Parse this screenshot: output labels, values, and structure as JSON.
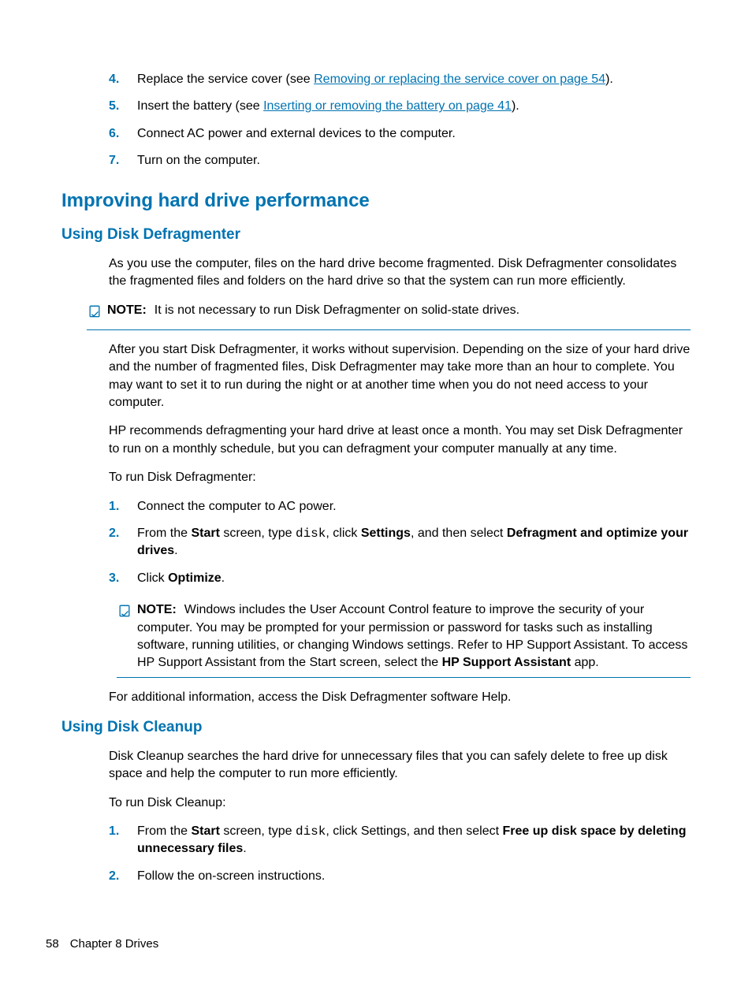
{
  "topList": {
    "items": [
      {
        "num": "4.",
        "pre": "Replace the service cover (see ",
        "link": "Removing or replacing the service cover on page 54",
        "post": ")."
      },
      {
        "num": "5.",
        "pre": "Insert the battery (see ",
        "link": "Inserting or removing the battery on page 41",
        "post": ")."
      },
      {
        "num": "6.",
        "text": "Connect AC power and external devices to the computer."
      },
      {
        "num": "7.",
        "text": "Turn on the computer."
      }
    ]
  },
  "section1": {
    "title": "Improving hard drive performance",
    "sub1": {
      "title": "Using Disk Defragmenter",
      "p1": "As you use the computer, files on the hard drive become fragmented. Disk Defragmenter consolidates the fragmented files and folders on the hard drive so that the system can run more efficiently.",
      "note1": {
        "label": "NOTE:",
        "text": "It is not necessary to run Disk Defragmenter on solid-state drives."
      },
      "p2": "After you start Disk Defragmenter, it works without supervision. Depending on the size of your hard drive and the number of fragmented files, Disk Defragmenter may take more than an hour to complete. You may want to set it to run during the night or at another time when you do not need access to your computer.",
      "p3": "HP recommends defragmenting your hard drive at least once a month. You may set Disk Defragmenter to run on a monthly schedule, but you can defragment your computer manually at any time.",
      "p4": "To run Disk Defragmenter:",
      "steps": [
        {
          "num": "1.",
          "text": "Connect the computer to AC power."
        },
        {
          "num": "2.",
          "pre": "From the ",
          "b1": "Start",
          "mid1": " screen, type ",
          "code": "disk",
          "mid2": ", click ",
          "b2": "Settings",
          "mid3": ", and then select ",
          "b3": "Defragment and optimize your drives",
          "post": "."
        },
        {
          "num": "3.",
          "pre": "Click ",
          "b1": "Optimize",
          "post": "."
        }
      ],
      "note2": {
        "label": "NOTE:",
        "pre": "Windows includes the User Account Control feature to improve the security of your computer. You may be prompted for your permission or password for tasks such as installing software, running utilities, or changing Windows settings. Refer to HP Support Assistant. To access HP Support Assistant from the Start screen, select the ",
        "b1": "HP Support Assistant",
        "post": " app."
      },
      "p5": "For additional information, access the Disk Defragmenter software Help."
    },
    "sub2": {
      "title": "Using Disk Cleanup",
      "p1": "Disk Cleanup searches the hard drive for unnecessary files that you can safely delete to free up disk space and help the computer to run more efficiently.",
      "p2": "To run Disk Cleanup:",
      "steps": [
        {
          "num": "1.",
          "pre": "From the ",
          "b1": "Start",
          "mid1": " screen, type ",
          "code": "disk",
          "mid2": ", click Settings, and then select ",
          "b2": "Free up disk space by deleting unnecessary files",
          "post": "."
        },
        {
          "num": "2.",
          "text": "Follow the on-screen instructions."
        }
      ]
    }
  },
  "footer": {
    "page": "58",
    "chapter": "Chapter 8   Drives"
  }
}
